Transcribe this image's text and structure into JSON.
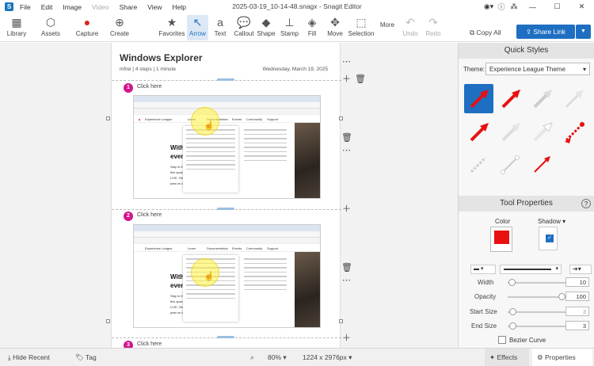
{
  "titlebar": {
    "menu": [
      "File",
      "Edit",
      "Image",
      "Video",
      "Share",
      "View",
      "Help"
    ],
    "title": "2025-03-19_10-14-48.snagx - Snagit Editor"
  },
  "toolbar": {
    "library": "Library",
    "assets": "Assets",
    "capture": "Capture",
    "create": "Create",
    "favorites": "Favorites",
    "arrow": "Arrow",
    "text": "Text",
    "callout": "Callout",
    "shape": "Shape",
    "stamp": "Stamp",
    "fill": "Fill",
    "move": "Move",
    "selection": "Selection",
    "more": "More",
    "undo": "Undo",
    "redo": "Redo",
    "copy_all": "Copy All",
    "share_link": "Share Link"
  },
  "doc": {
    "title": "Windows Explorer",
    "meta": "mfrei | 4 steps | 1 minute",
    "date": "Wednesday, March 19, 2025",
    "steps": [
      {
        "num": "1",
        "label": "Click here"
      },
      {
        "num": "2",
        "label": "Click here"
      },
      {
        "num": "3",
        "label": "Click here"
      }
    ],
    "shot": {
      "nav_brand": "Experience League",
      "nav_items": [
        "Learn",
        "Documentation",
        "Events",
        "Community",
        "Support"
      ],
      "headline1": "With Ex",
      "headline2": "event.",
      "p1": "Stay in the loop",
      "p2": "this space often",
      "p3": "LIVE, Skill Buildi",
      "p4": "past on demand"
    }
  },
  "panel": {
    "quick_styles": "Quick Styles",
    "theme_label": "Theme:",
    "theme_value": "Experience League Theme",
    "tool_properties": "Tool Properties",
    "color": "Color",
    "shadow": "Shadow",
    "width_label": "Width",
    "width_val": "10",
    "opacity_label": "Opacity",
    "opacity_val": "100",
    "start_label": "Start Size",
    "start_val": "3",
    "end_label": "End Size",
    "end_val": "3",
    "bezier": "Bezier Curve",
    "accent": "#e81010"
  },
  "status": {
    "hide_recent": "Hide Recent",
    "tag": "Tag",
    "zoom": "80%",
    "dims": "1224 x 2976px",
    "effects": "Effects",
    "properties": "Properties"
  }
}
